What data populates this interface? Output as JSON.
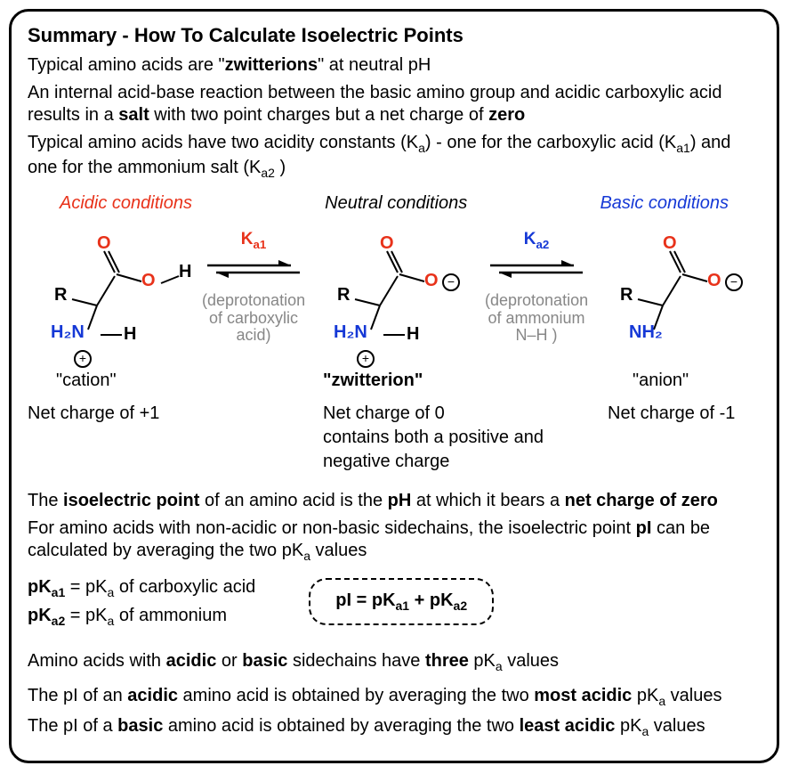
{
  "title": "Summary - How To Calculate Isoelectric Points",
  "p1a": "Typical amino acids are \"",
  "p1b": "zwitterions",
  "p1c": "\" at neutral pH",
  "p2a": "An internal acid-base reaction between the basic amino group and acidic carboxylic acid results in a ",
  "p2b": "salt",
  "p2c": " with two point charges but a net charge of ",
  "p2d": "zero",
  "p3a": "Typical amino acids have two acidity constants (K",
  "p3b": ") - one for the carboxylic acid (K",
  "p3c": ") and one for the ammonium salt (K",
  "p3d": " )",
  "cond_acid": "Acidic conditions",
  "cond_neutral": "Neutral conditions",
  "cond_basic": "Basic conditions",
  "ka1": "K",
  "ka1_sub": "a1",
  "ka2": "K",
  "ka2_sub": "a2",
  "eq1_note": "(deprotonation of carboxylic acid)",
  "eq2_note": "(deprotonation of ammonium N–H )",
  "lbl_cation": "\"cation\"",
  "lbl_zwit": "\"zwitterion\"",
  "lbl_anion": "\"anion\"",
  "charge1": "Net charge of +1",
  "charge2": "Net charge of 0",
  "charge3": "Net charge of -1",
  "zwit_note": "contains both a positive and negative charge",
  "p4a": "The ",
  "p4b": "isoelectric point",
  "p4c": " of an amino acid is the ",
  "p4d": "pH",
  "p4e": " at which it bears a ",
  "p4f": "net charge of zero",
  "p5a": "For amino acids with non-acidic or non-basic sidechains, the isoelectric point ",
  "p5b": "pI",
  "p5c": " can be calculated by averaging the two pK",
  "p5d": " values",
  "def1a": "pK",
  "def1b": " = pK",
  "def1c": " of carboxylic acid",
  "def2a": "pK",
  "def2b": " = pK",
  "def2c": " of ammonium",
  "formula_a": "pI = pK",
  "formula_b": " + pK",
  "p6a": "Amino acids with ",
  "p6b": "acidic",
  "p6c": " or ",
  "p6d": "basic",
  "p6e": " sidechains have ",
  "p6f": "three",
  "p6g": " pK",
  "p6h": " values",
  "p7a": "The pI of an ",
  "p7b": "acidic",
  "p7c": " amino acid is obtained by averaging the two ",
  "p7d": "most acidic",
  "p7e": " pK",
  "p7f": " values",
  "p8a": "The pI of a ",
  "p8b": "basic",
  "p8c": " amino acid is obtained by averaging the two ",
  "p8d": "least acidic",
  "p8e": " pK",
  "p8f": " values",
  "a_sub": "a",
  "R": "R",
  "O": "O",
  "H": "H",
  "H2N": "H₂N",
  "NH2": "NH₂",
  "Ominus": "O",
  "plus": "+",
  "minus": "−"
}
